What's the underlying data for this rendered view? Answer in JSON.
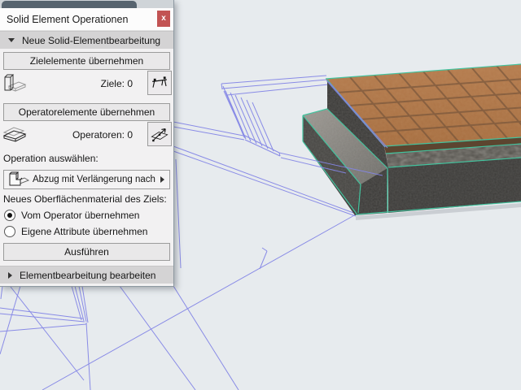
{
  "panel": {
    "title": "Solid Element Operationen",
    "close_label": "x",
    "sections": {
      "new_operation": {
        "label": "Neue Solid-Elementbearbeitung"
      },
      "edit_operation": {
        "label": "Elementbearbeitung bearbeiten"
      }
    },
    "targets": {
      "button": "Zielelemente übernehmen",
      "count_label": "Ziele: 0"
    },
    "operators": {
      "button": "Operatorelemente übernehmen",
      "count_label": "Operatoren: 0"
    },
    "operation": {
      "label": "Operation auswählen:",
      "selected": "Abzug mit Verlängerung nach ..."
    },
    "surface": {
      "label": "Neues Oberflächenmaterial des Ziels:",
      "options": [
        {
          "label": "Vom Operator übernehmen",
          "selected": true
        },
        {
          "label": "Eigene Attribute übernehmen",
          "selected": false
        }
      ]
    },
    "execute_button": "Ausführen"
  },
  "viewport": {
    "background_color": "#e7ebee",
    "wireframe_color": "#8486e6",
    "selection_highlight_color": "#43c39e",
    "tile_color": "#b5794b",
    "concrete_color": "#3c3b39",
    "content": "3D view: wireframe stair/railing elements, selected solid slab with terracotta tile top, gravel layer and concrete base with step"
  }
}
